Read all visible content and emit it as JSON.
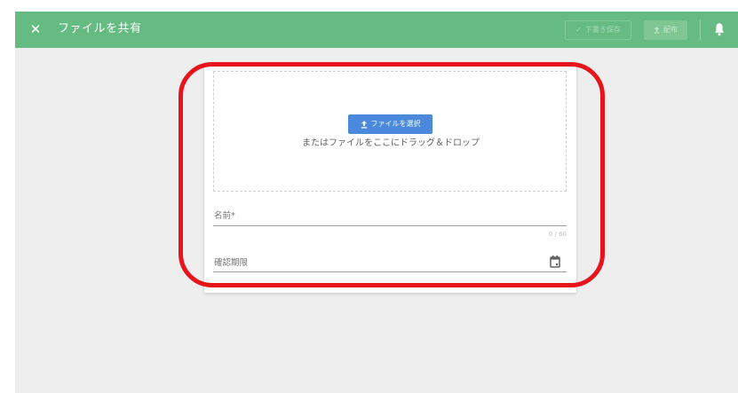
{
  "header": {
    "close_icon": "close-icon",
    "title": "ファイルを共有",
    "save_draft_label": "下書き保存",
    "distribute_label": "配布",
    "notification_icon": "bell-icon"
  },
  "upload": {
    "select_file_label": "ファイルを選択",
    "drop_hint": "またはファイルをここにドラッグ＆ドロップ"
  },
  "form": {
    "name_label": "名前*",
    "name_counter": "0 / 60",
    "due_date_label": "確認期限",
    "calendar_icon": "calendar-icon"
  },
  "colors": {
    "header_bg": "#66bb82",
    "primary_button": "#4a89dc",
    "highlight_ring": "#e8141b",
    "page_bg": "#eeeeee"
  }
}
